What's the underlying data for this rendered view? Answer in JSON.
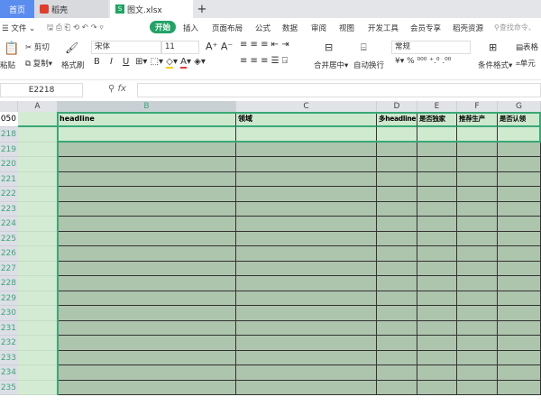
{
  "tabs": [
    {
      "label": "首页"
    },
    {
      "label": "稻壳"
    },
    {
      "label": "图文.xlsx"
    }
  ],
  "menu": {
    "file": "文件",
    "items": [
      "开始",
      "插入",
      "页面布局",
      "公式",
      "数据",
      "审阅",
      "视图",
      "开发工具",
      "会员专享",
      "稻壳资源"
    ],
    "search_placeholder": "查找命令、"
  },
  "toolbar": {
    "paste": "粘贴",
    "cut": "剪切",
    "copy": "复制",
    "format_painter": "格式刷",
    "font": "宋体",
    "size": "11",
    "bold": "B",
    "italic": "I",
    "underline": "U",
    "merge": "合并居中",
    "wrap": "自动换行",
    "number_format": "常规",
    "currency": "¥",
    "percent": "%",
    "cond_format": "条件格式",
    "table_style": "表格",
    "cell": "单元"
  },
  "formula_bar": {
    "name_box": "E2218",
    "fx": "fx",
    "value": ""
  },
  "columns": [
    "A",
    "B",
    "C",
    "D",
    "E",
    "F",
    "G"
  ],
  "header_row": {
    "num": "050",
    "cells": [
      "",
      "headline",
      "领域",
      "多headline",
      "是否独家",
      "推荐生产",
      "是否认领"
    ]
  },
  "rows": [
    "218",
    "219",
    "220",
    "221",
    "222",
    "223",
    "224",
    "225",
    "226",
    "227",
    "228",
    "229",
    "230",
    "231",
    "232",
    "233",
    "234",
    "235"
  ],
  "active_column": "B"
}
